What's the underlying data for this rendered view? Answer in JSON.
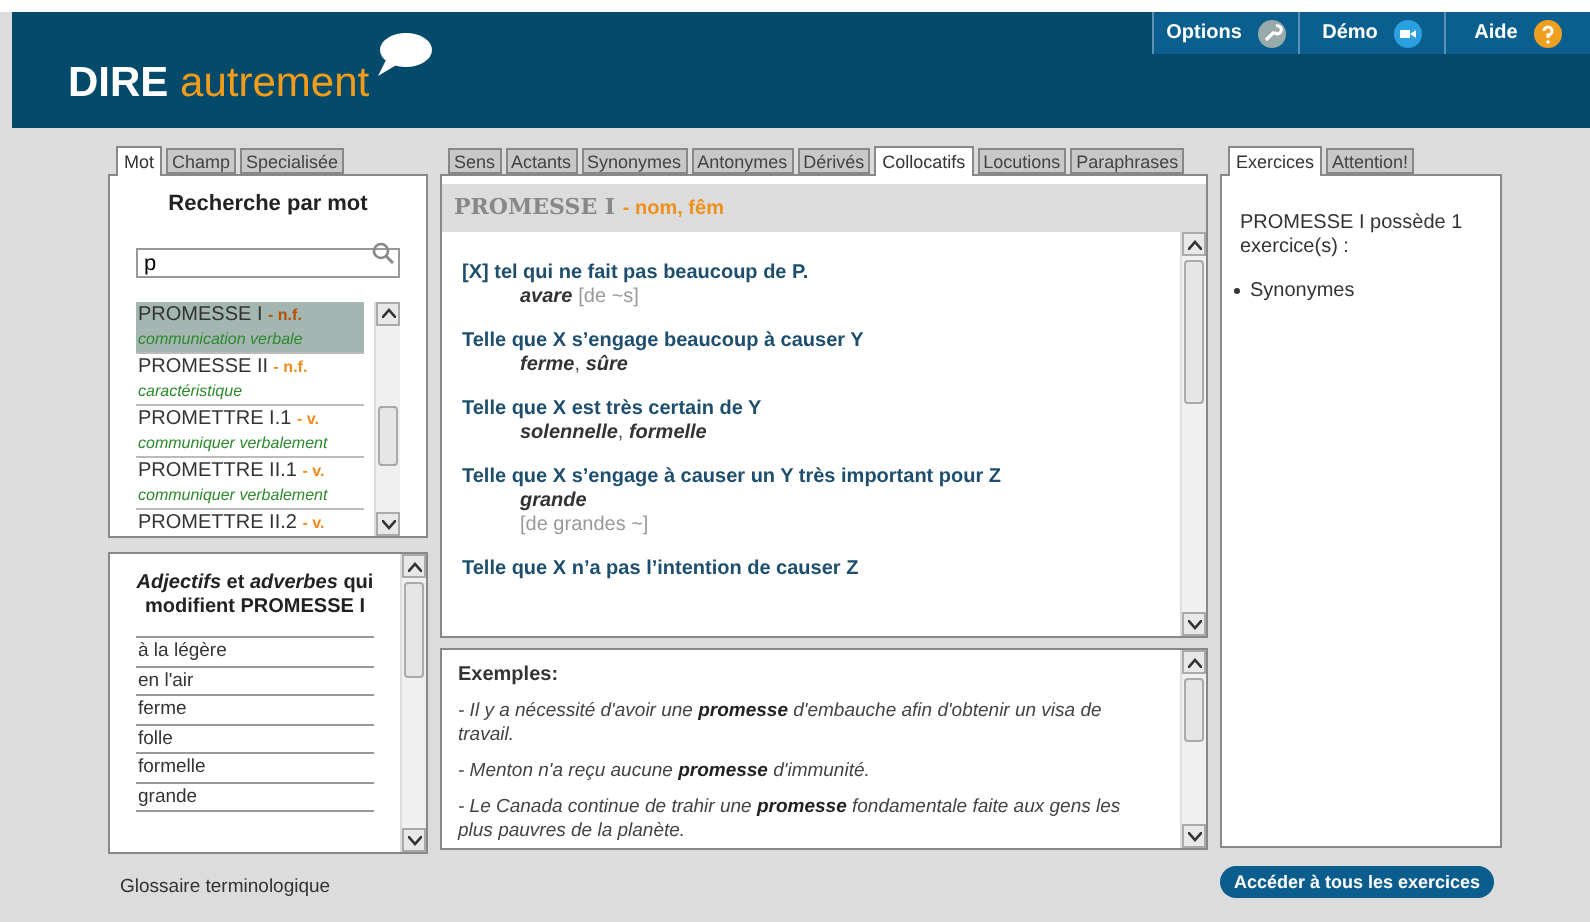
{
  "header": {
    "logo_bold": "DIRE",
    "logo_light": "autrement",
    "nav": [
      {
        "label": "Options"
      },
      {
        "label": "Démo"
      },
      {
        "label": "Aide"
      }
    ]
  },
  "left_tabs": [
    {
      "label": "Mot",
      "selected": true
    },
    {
      "label": "Champ",
      "selected": false
    },
    {
      "label": "Specialisée",
      "selected": false
    }
  ],
  "search_panel": {
    "title": "Recherche par mot",
    "search_value": "p",
    "words": [
      {
        "term": "PROMESSE I",
        "pos": "- n.f.",
        "domain": "communication verbale",
        "selected": true
      },
      {
        "term": "PROMESSE II",
        "pos": "- n.f.",
        "domain": "caractéristique",
        "selected": false
      },
      {
        "term": "PROMETTRE I.1",
        "pos": "- v.",
        "domain": "communiquer verbalement",
        "selected": false
      },
      {
        "term": "PROMETTRE II.1",
        "pos": "- v.",
        "domain": "communiquer verbalement",
        "selected": false
      },
      {
        "term": "PROMETTRE II.2",
        "pos": "- v.",
        "selected": false
      }
    ]
  },
  "modifiers_panel": {
    "title": "*Adjectifs* et *adverbes*",
    "subtitle": "qui modifient PROMESSE I",
    "items": [
      "à la légère",
      "en l'air",
      "ferme",
      "folle",
      "formelle",
      "grande"
    ]
  },
  "footer_link": "Glossaire terminologique",
  "middle_tabs": [
    {
      "label": "Sens",
      "selected": false
    },
    {
      "label": "Actants",
      "selected": false
    },
    {
      "label": "Synonymes",
      "selected": false
    },
    {
      "label": "Antonymes",
      "selected": false
    },
    {
      "label": "Dérivés",
      "selected": false
    },
    {
      "label": "Collocatifs",
      "selected": true
    },
    {
      "label": "Locutions",
      "selected": false
    },
    {
      "label": "Paraphrases",
      "selected": false
    }
  ],
  "entry": {
    "headword": "PROMESSE I",
    "category": "- nom, fêm",
    "collocations": [
      {
        "definition": "[X] tel qui ne fait pas beaucoup de P.",
        "words": "*avare*",
        "note": "[de ~s]",
        "kind": "inline"
      },
      {
        "definition": "Telle que X s’engage beaucoup à causer Y",
        "words": "*ferme*, *sûre*"
      },
      {
        "definition": "Telle que X est très certain de Y",
        "words": "*solennelle*, *formelle*"
      },
      {
        "definition": "Telle que X s’engage à causer un Y très important pour Z",
        "words": "*grande*",
        "note": "[de grandes ~]",
        "kind": "below"
      },
      {
        "definition": "Telle que X n’a pas l’intention de causer Z"
      }
    ]
  },
  "examples": {
    "title": "Exemples:",
    "sentences": [
      "- Il y a nécessité d'avoir une **promesse** d'embauche afin d'obtenir un visa de travail.",
      "- Menton n'a reçu aucune **promesse** d'immunité.",
      "- Le Canada continue de trahir une **promesse** fondamentale faite aux gens les plus pauvres de la planète."
    ]
  },
  "right_tabs": [
    {
      "label": "Exercices",
      "selected": true
    },
    {
      "label": "Attention!",
      "selected": false
    }
  ],
  "exercises": {
    "text": "PROMESSE I possède 1 exercice(s) :",
    "items": [
      "Synonymes"
    ],
    "button": "Accéder à tous les exercices"
  }
}
